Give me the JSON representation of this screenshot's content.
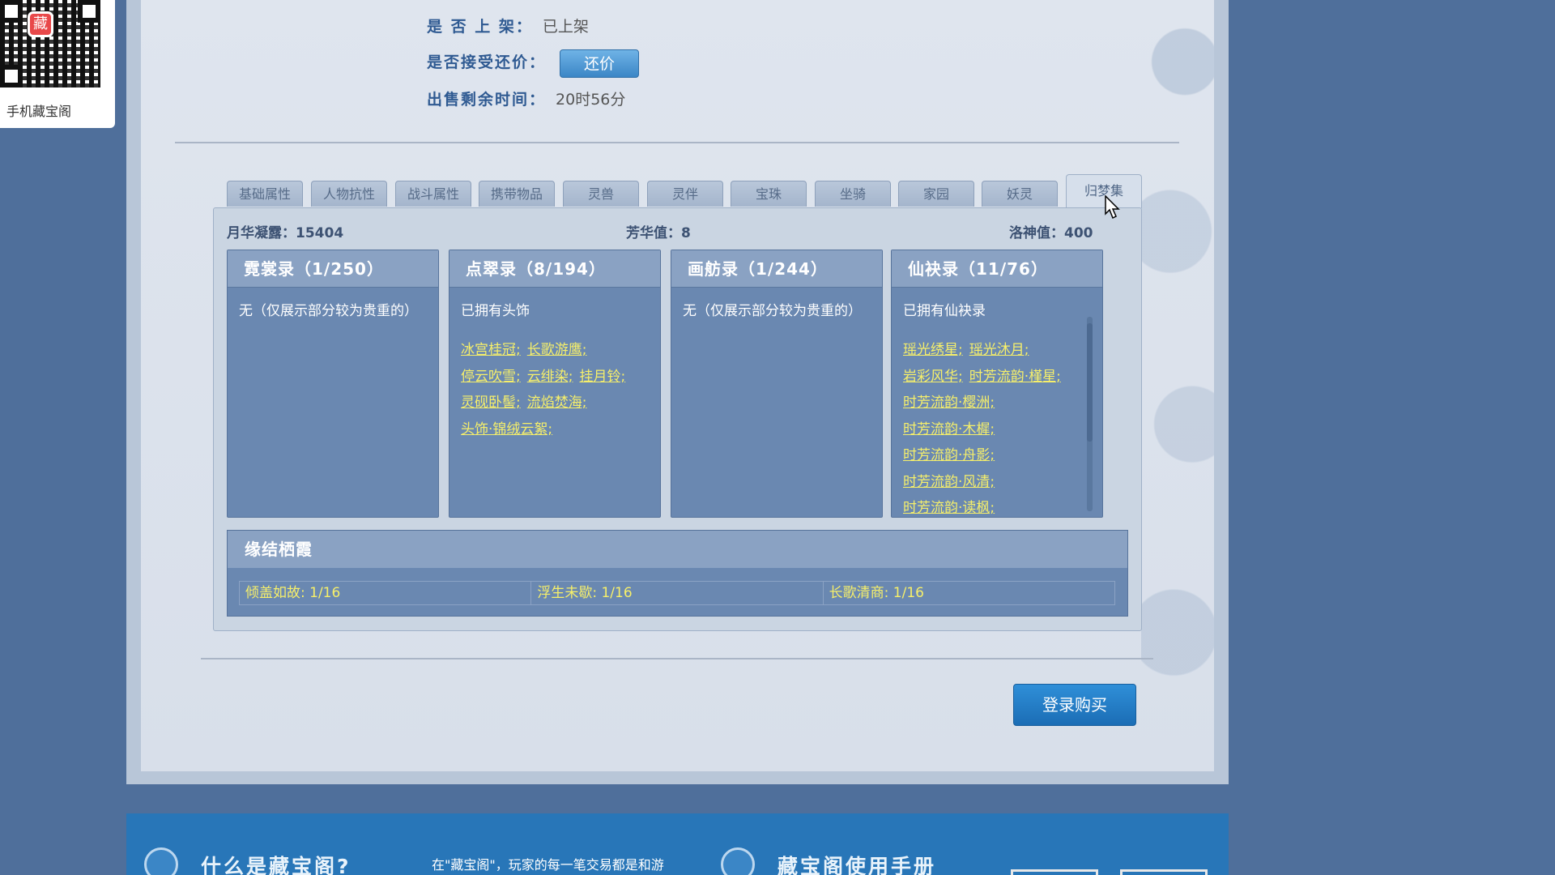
{
  "qr": {
    "label": "手机藏宝阁",
    "logo": "藏"
  },
  "info": {
    "on_shelf_label": "是 否 上 架：",
    "on_shelf_value": "已上架",
    "haggle_label": "是否接受还价：",
    "haggle_button": "还价",
    "remaining_label": "出售剩余时间：",
    "remaining_value": "20时56分"
  },
  "tabs": [
    "基础属性",
    "人物抗性",
    "战斗属性",
    "携带物品",
    "灵兽",
    "灵伴",
    "宝珠",
    "坐骑",
    "家园",
    "妖灵",
    "归梦集"
  ],
  "active_tab": "归梦集",
  "stats": {
    "moon": "月华凝露：15404",
    "fang": "芳华值：8",
    "luo": "洛神值：400"
  },
  "cards": [
    {
      "title": "霓裳录（1/250）",
      "sub": "无（仅展示部分较为贵重的）",
      "links": []
    },
    {
      "title": "点翠录（8/194）",
      "sub": "已拥有头饰",
      "links": [
        [
          "冰宫桂冠;",
          "长歌游鹰;"
        ],
        [
          "停云吹雪;",
          "云绯染;",
          "挂月铃;"
        ],
        [
          "灵砚卧髻;",
          "流焰焚海;"
        ],
        [
          "头饰·锦绒云絮;"
        ]
      ]
    },
    {
      "title": "画舫录（1/244）",
      "sub": "无（仅展示部分较为贵重的）",
      "links": []
    },
    {
      "title": "仙袂录（11/76）",
      "sub": "已拥有仙袂录",
      "links": [
        [
          "瑶光绣星;",
          "瑶光沐月;"
        ],
        [
          "岩彩风华;",
          "时芳流韵·槿星;"
        ],
        [
          "时芳流韵·樱洲;"
        ],
        [
          "时芳流韵·木樨;"
        ],
        [
          "时芳流韵·舟影;"
        ],
        [
          "时芳流韵·风清;"
        ],
        [
          "时芳流韵·读枫;"
        ]
      ]
    }
  ],
  "bonds": {
    "title": "缘结栖霞",
    "items": [
      "倾盖如故: 1/16",
      "浮生未歇: 1/16",
      "长歌清商: 1/16"
    ]
  },
  "buy_button": "登录购买",
  "footer": {
    "title1": "什么是藏宝阁?",
    "text": "在\"藏宝阁\"，玩家的每一笔交易都是和游",
    "title2": "藏宝阁使用手册"
  }
}
